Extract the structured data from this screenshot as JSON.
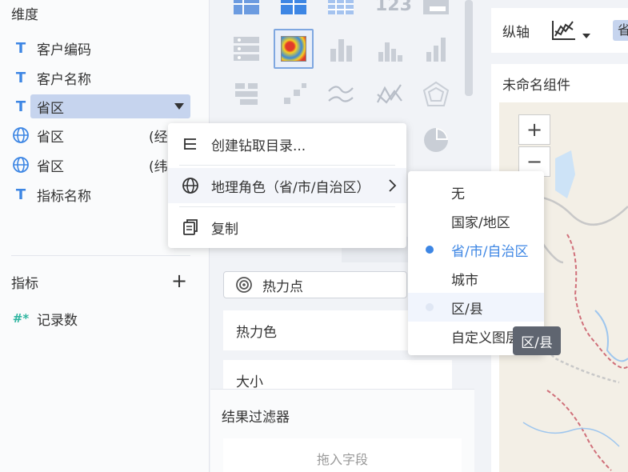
{
  "left_panel": {
    "dimension_title": "维度",
    "dimensions": [
      {
        "type": "text",
        "label": "客户编码"
      },
      {
        "type": "text",
        "label": "客户名称"
      },
      {
        "type": "text",
        "label": "省区",
        "selected": true
      },
      {
        "type": "geo",
        "label": "省区",
        "suffix": "(经"
      },
      {
        "type": "geo",
        "label": "省区",
        "suffix": "(纬"
      },
      {
        "type": "text",
        "label": "指标名称"
      }
    ],
    "metric_title": "指标",
    "metrics": [
      {
        "label": "记录数",
        "badge": "#*"
      }
    ]
  },
  "middle_panel": {
    "top_icons": [
      "table-icon",
      "crosstab-icon",
      "detail-table-icon",
      "kpi-number-icon",
      "kpi-card-icon"
    ],
    "kpi_text": "123",
    "heat_point_label": "热力点",
    "heat_color_label": "热力色",
    "size_label": "大小",
    "filter_title": "结果过滤器",
    "drop_placeholder": "拖入字段"
  },
  "right_panel": {
    "axis_label": "纵轴",
    "axis_chip": "省",
    "component_title": "未命名组件",
    "zoom_in": "+",
    "zoom_out": "−"
  },
  "context_menu": {
    "items": [
      {
        "label": "创建钻取目录...",
        "icon": "drill-tree-icon"
      },
      {
        "label": "地理角色（省/市/自治区）",
        "icon": "globe-icon",
        "has_submenu": true
      },
      {
        "label": "复制",
        "icon": "copy-icon"
      }
    ]
  },
  "submenu": {
    "items": [
      {
        "label": "无"
      },
      {
        "label": "国家/地区"
      },
      {
        "label": "省/市/自治区",
        "active": true
      },
      {
        "label": "城市"
      },
      {
        "label": "区/县",
        "hover": true
      },
      {
        "label": "自定义图层"
      }
    ]
  },
  "tooltip": {
    "text": "区/县"
  },
  "colors": {
    "accent": "#3d86e4",
    "selected_bg": "#c6d4ee",
    "hash": "#2fb5a0"
  }
}
